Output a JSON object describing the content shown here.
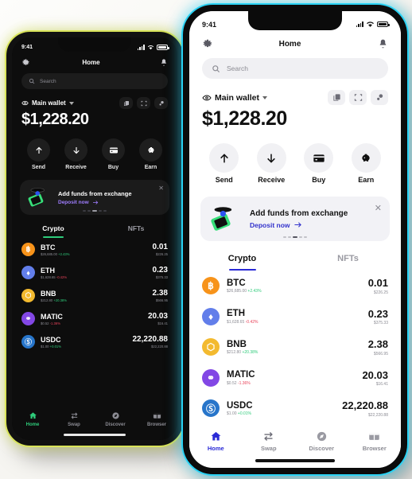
{
  "status_bar": {
    "time": "9:41",
    "signal_icon": "signal-bars-icon",
    "wifi_icon": "wifi-icon",
    "battery_icon": "battery-icon"
  },
  "header": {
    "title": "Home",
    "settings_icon": "gear-icon",
    "notifications_icon": "bell-icon"
  },
  "search": {
    "placeholder": "Search",
    "icon": "search-icon"
  },
  "wallet": {
    "eye_icon": "eye-icon",
    "name": "Main wallet",
    "chevron_icon": "chevron-down-icon",
    "balance": "$1,228.20",
    "tools": [
      {
        "name": "copy-address-icon",
        "label": "Copy"
      },
      {
        "name": "scan-qr-icon",
        "label": "Scan"
      },
      {
        "name": "connections-icon",
        "label": "Connections"
      }
    ]
  },
  "actions": [
    {
      "label": "Send",
      "icon": "arrow-up-icon"
    },
    {
      "label": "Receive",
      "icon": "arrow-down-icon"
    },
    {
      "label": "Buy",
      "icon": "credit-card-icon"
    },
    {
      "label": "Earn",
      "icon": "piggy-bank-icon"
    }
  ],
  "banner": {
    "title": "Add funds from exchange",
    "cta": "Deposit now",
    "cta_arrow": "arrow-right-icon",
    "close_icon": "close-icon",
    "illustration": "phone-with-coin-illustration",
    "dots_total": 5,
    "dots_active_index": 2
  },
  "tabs": [
    {
      "label": "Crypto",
      "active": true
    },
    {
      "label": "NFTs",
      "active": false
    }
  ],
  "assets": [
    {
      "symbol": "BTC",
      "glyph": "฿",
      "color": "#f7931a",
      "price": "$26,685.00",
      "change": "+2.43%",
      "direction": "up",
      "amount": "0.01",
      "fiat": "$226.25"
    },
    {
      "symbol": "ETH",
      "glyph": "♦",
      "color": "#627eea",
      "price": "$1,628.65",
      "change": "-0.42%",
      "direction": "down",
      "amount": "0.23",
      "fiat": "$375.33"
    },
    {
      "symbol": "BNB",
      "glyph": "⬡",
      "color": "#f3ba2f",
      "price": "$212.80",
      "change": "+20.38%",
      "direction": "up",
      "amount": "2.38",
      "fiat": "$566.95"
    },
    {
      "symbol": "MATIC",
      "glyph": "⚭",
      "color": "#8247e5",
      "price": "$0.52",
      "change": "-1.36%",
      "direction": "down",
      "amount": "20.03",
      "fiat": "$16.41"
    },
    {
      "symbol": "USDC",
      "glyph": "Ⓢ",
      "color": "#2775ca",
      "price": "$1.00",
      "change": "+0.01%",
      "direction": "up",
      "amount": "22,220.88",
      "fiat": "$22,220.88"
    }
  ],
  "bottom_nav": [
    {
      "label": "Home",
      "icon": "home-icon",
      "active": true
    },
    {
      "label": "Swap",
      "icon": "swap-icon",
      "active": false
    },
    {
      "label": "Discover",
      "icon": "compass-icon",
      "active": false
    },
    {
      "label": "Browser",
      "icon": "browser-icon",
      "active": false
    }
  ],
  "theme": {
    "dark_accent": "#2ecb7a",
    "light_accent": "#2a2ad6",
    "dark_glow": "#d9e45a",
    "light_glow": "#29d3f5"
  }
}
